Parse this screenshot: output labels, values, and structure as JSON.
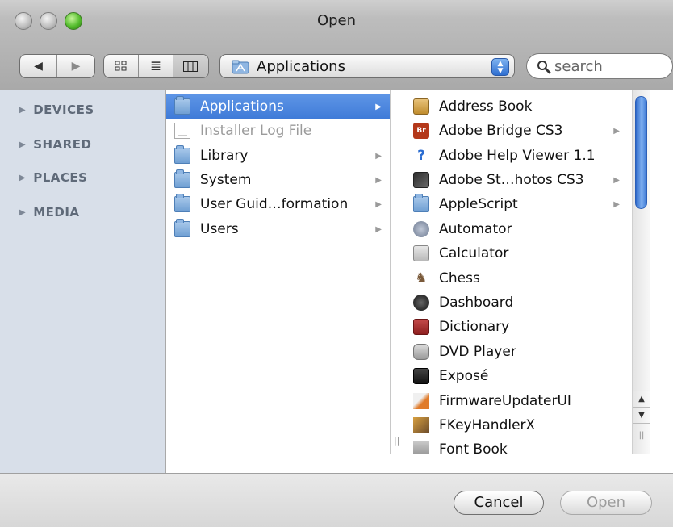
{
  "window": {
    "title": "Open"
  },
  "toolbar": {
    "back_glyph": "◀",
    "forward_glyph": "▶",
    "view_icon": "▪▪",
    "list_glyph": "≣",
    "column_glyph": "▥",
    "path_label": "Applications",
    "search_placeholder": "search"
  },
  "sidebar": {
    "sections": [
      {
        "label": "DEVICES"
      },
      {
        "label": "SHARED"
      },
      {
        "label": "PLACES"
      },
      {
        "label": "MEDIA"
      }
    ]
  },
  "column1": {
    "items": [
      {
        "label": "Applications",
        "icon": "applications-folder-icon",
        "state": "selected",
        "has_children": true
      },
      {
        "label": "Installer Log File",
        "icon": "document-icon",
        "state": "disabled",
        "has_children": false
      },
      {
        "label": "Library",
        "icon": "library-folder-icon",
        "state": "normal",
        "has_children": true
      },
      {
        "label": "System",
        "icon": "system-folder-icon",
        "state": "normal",
        "has_children": true
      },
      {
        "label": "User Guid…formation",
        "icon": "alias-folder-icon",
        "state": "normal",
        "has_children": true
      },
      {
        "label": "Users",
        "icon": "users-folder-icon",
        "state": "normal",
        "has_children": true
      }
    ]
  },
  "column2": {
    "items": [
      {
        "label": "Address Book",
        "icon": "address-book-icon",
        "has_children": false
      },
      {
        "label": "Adobe Bridge CS3",
        "icon": "adobe-bridge-icon",
        "has_children": true
      },
      {
        "label": "Adobe Help Viewer 1.1",
        "icon": "help-viewer-icon",
        "has_children": false
      },
      {
        "label": "Adobe St…hotos CS3",
        "icon": "adobe-stock-photos-icon",
        "has_children": true
      },
      {
        "label": "AppleScript",
        "icon": "folder-icon",
        "has_children": true
      },
      {
        "label": "Automator",
        "icon": "automator-icon",
        "has_children": false
      },
      {
        "label": "Calculator",
        "icon": "calculator-icon",
        "has_children": false
      },
      {
        "label": "Chess",
        "icon": "chess-icon",
        "has_children": false
      },
      {
        "label": "Dashboard",
        "icon": "dashboard-icon",
        "has_children": false
      },
      {
        "label": "Dictionary",
        "icon": "dictionary-icon",
        "has_children": false
      },
      {
        "label": "DVD Player",
        "icon": "dvd-player-icon",
        "has_children": false
      },
      {
        "label": "Exposé",
        "icon": "expose-icon",
        "has_children": false
      },
      {
        "label": "FirmwareUpdaterUI",
        "icon": "firmware-updater-icon",
        "has_children": false
      },
      {
        "label": "FKeyHandlerX",
        "icon": "fkeyhandler-icon",
        "has_children": false
      },
      {
        "label": "Font Book",
        "icon": "font-book-icon",
        "has_children": false
      }
    ]
  },
  "buttons": {
    "cancel": "Cancel",
    "open": "Open"
  },
  "colors": {
    "selection": "#3f7bd8",
    "sidebar": "#d8dfe9",
    "zoom_button": "#55bd2e"
  }
}
